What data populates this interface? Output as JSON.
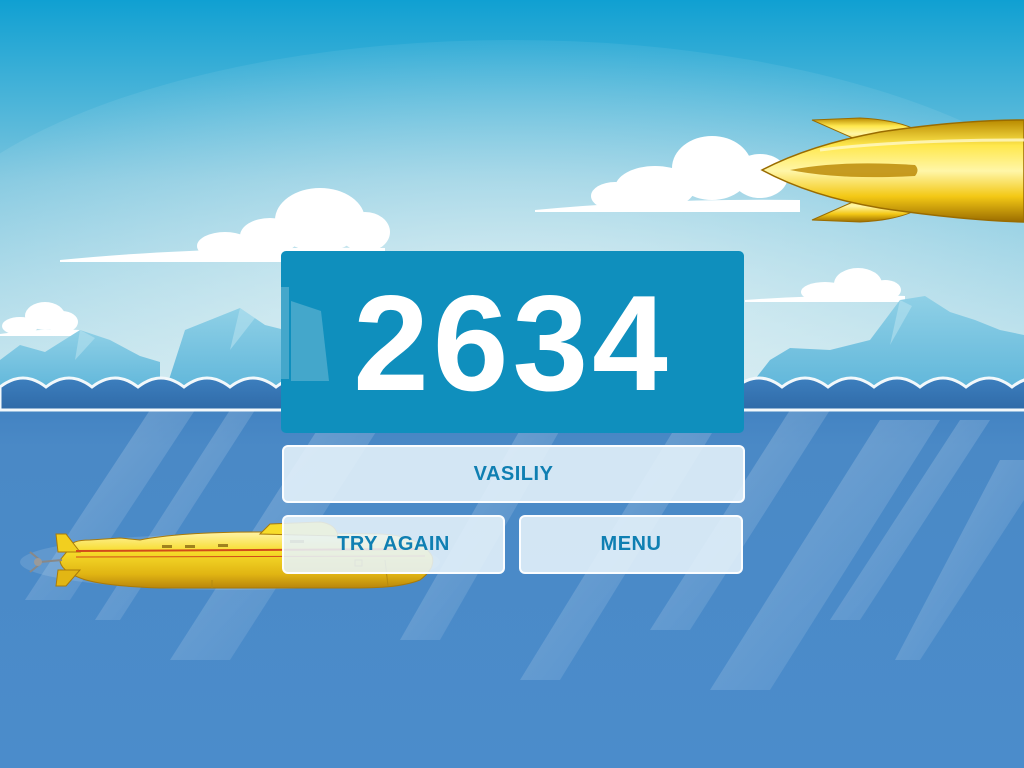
{
  "game": {
    "score": "2634",
    "player_name": "VASILIY",
    "buttons": {
      "try_again": "TRY AGAIN",
      "menu": "MENU"
    }
  },
  "colors": {
    "sky_top": "#1ea6d4",
    "sky_horizon": "#c3e3ec",
    "water_top": "#4a86c3",
    "water_bottom": "#4b8bcb",
    "score_panel": "#0f8fbd",
    "button_fill": "rgba(230,242,250,0.88)",
    "button_text": "#0f7fb2",
    "submarine_body": "#f5d21c"
  },
  "icons": {
    "score_panel_ship": "sailing-ship-icon",
    "player_submarine": "submarine-icon",
    "enemy_rocket": "rocket-icon"
  }
}
